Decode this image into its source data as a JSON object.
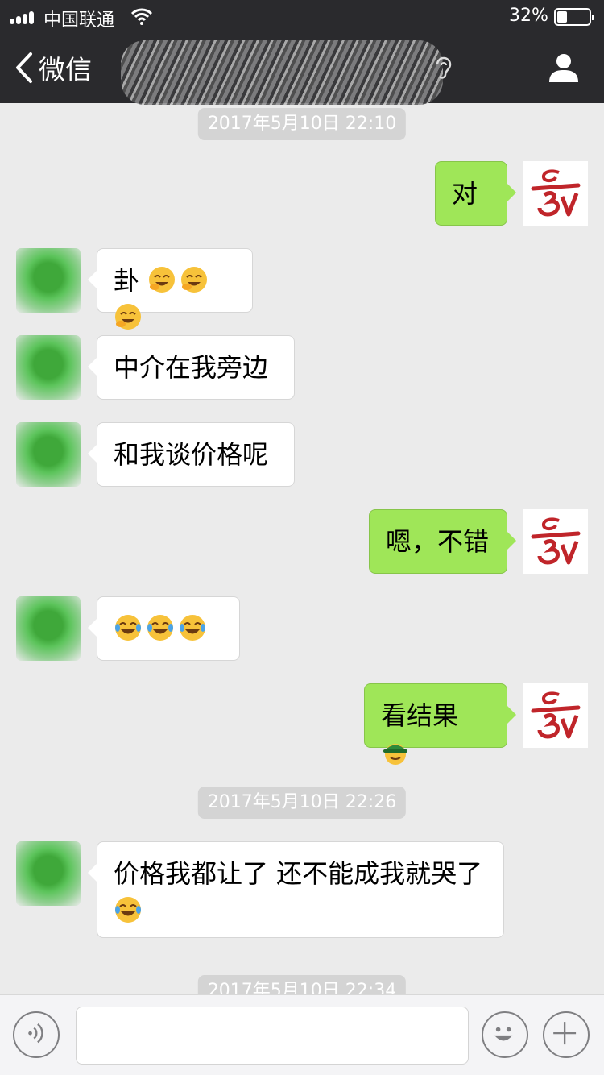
{
  "status_bar": {
    "carrier": "中国联通",
    "battery": "32%",
    "battery_level": 0.32
  },
  "nav": {
    "back_label": "微信"
  },
  "messages": [
    {
      "type": "timestamp",
      "text": "2017年5月10日 22:10"
    },
    {
      "type": "sent",
      "text": "对"
    },
    {
      "type": "received",
      "text": "卦",
      "emoji": [
        "face-with-hand-laughing",
        "face-with-hand-laughing",
        "face-with-hand-laughing"
      ]
    },
    {
      "type": "received",
      "text": "中介在我旁边"
    },
    {
      "type": "received",
      "text": "和我谈价格呢"
    },
    {
      "type": "sent",
      "text": "嗯，不错"
    },
    {
      "type": "received",
      "text": "",
      "emoji": [
        "tears-of-joy",
        "tears-of-joy",
        "tears-of-joy"
      ]
    },
    {
      "type": "sent",
      "text": "看结果",
      "emoji": [
        "green-hat-face"
      ]
    },
    {
      "type": "timestamp",
      "text": "2017年5月10日 22:26"
    },
    {
      "type": "received",
      "text": "价格我都让了 还不能成我就哭了",
      "emoji": [
        "tears-of-joy"
      ]
    },
    {
      "type": "timestamp",
      "text": "2017年5月10日 22:34"
    }
  ],
  "colors": {
    "nav_bg": "#2a2a2d",
    "chat_bg": "#ebebeb",
    "sent_bubble": "#9fe658",
    "received_bubble": "#ffffff"
  }
}
